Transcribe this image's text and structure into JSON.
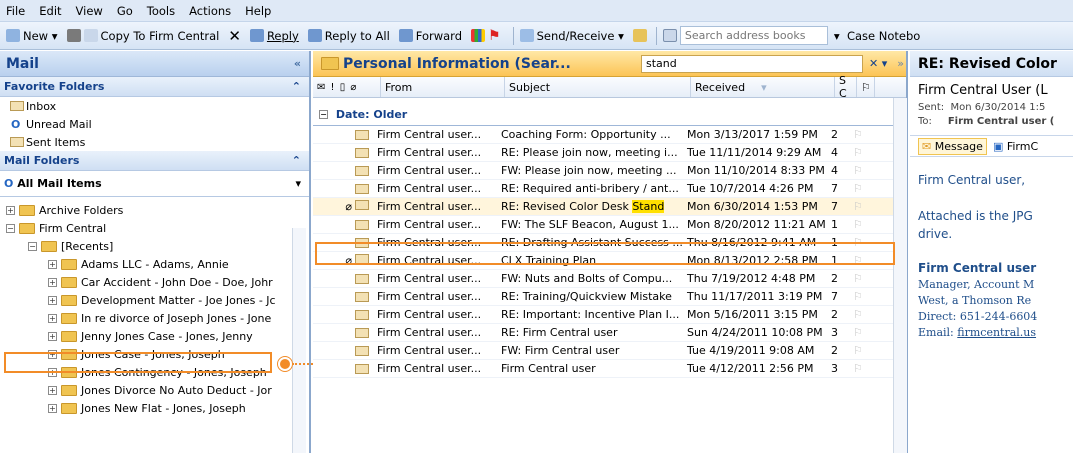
{
  "menu": [
    "File",
    "Edit",
    "View",
    "Go",
    "Tools",
    "Actions",
    "Help"
  ],
  "toolbar": {
    "new": "New",
    "copy_to": "Copy To Firm Central",
    "reply": "Reply",
    "reply_all": "Reply to All",
    "forward": "Forward",
    "send_receive": "Send/Receive",
    "search_ab": "Search address books",
    "case_notebook": "Case Notebo"
  },
  "nav": {
    "title": "Mail",
    "fav_title": "Favorite Folders",
    "favorites": [
      "Inbox",
      "Unread Mail",
      "Sent Items"
    ],
    "mail_folders_title": "Mail Folders",
    "all_mail": "All Mail Items",
    "tree": [
      "Archive Folders",
      "Firm Central",
      "[Recents]",
      "Adams LLC - Adams, Annie",
      "Car Accident - John Doe - Doe, Johr",
      "Development Matter - Joe Jones - Jc",
      "In re divorce of Joseph Jones - Jone",
      "Jenny Jones Case - Jones, Jenny",
      "Jones Case - Jones, Joseph",
      "Jones Contingency - Jones, Joseph",
      "Jones Divorce No Auto Deduct - Jor",
      "Jones New Flat - Jones, Joseph"
    ]
  },
  "list": {
    "title": "Personal Information (Sear...",
    "search_value": "stand",
    "cols": {
      "from": "From",
      "subject": "Subject",
      "received": "Received",
      "sc": "S C"
    },
    "group": "Date: Older",
    "rows": [
      {
        "from": "Firm Central user...",
        "subject": "Coaching Form: Opportunity ...",
        "received": "Mon 3/13/2017 1:59 PM",
        "size": "2"
      },
      {
        "from": "Firm Central user...",
        "subject": "RE: Please join now, meeting i...",
        "received": "Tue 11/11/2014 9:29 AM",
        "size": "4"
      },
      {
        "from": "Firm Central user...",
        "subject": "FW: Please join now, meeting ...",
        "received": "Mon 11/10/2014 8:33 PM",
        "size": "4"
      },
      {
        "from": "Firm Central user...",
        "subject": "RE: Required anti-bribery / ant...",
        "received": "Tue 10/7/2014 4:26 PM",
        "size": "7"
      },
      {
        "from": "Firm Central user...",
        "subject": "RE: Revised Color Desk ",
        "subject_hl": "Stand",
        "received": "Mon 6/30/2014 1:53 PM",
        "size": "7"
      },
      {
        "from": "Firm Central user...",
        "subject": "FW: The SLF Beacon, August 1...",
        "received": "Mon 8/20/2012 11:21 AM",
        "size": "1"
      },
      {
        "from": "Firm Central user...",
        "subject": "RE: Drafting Assistant Success ...",
        "received": "Thu 8/16/2012 9:41 AM",
        "size": "1"
      },
      {
        "from": "Firm Central user...",
        "subject": "CLX Training Plan",
        "received": "Mon 8/13/2012 2:58 PM",
        "size": "1"
      },
      {
        "from": "Firm Central user...",
        "subject": "FW: Nuts and Bolts of Compu...",
        "received": "Thu 7/19/2012 4:48 PM",
        "size": "2"
      },
      {
        "from": "Firm Central user...",
        "subject": "RE: Training/Quickview Mistake",
        "received": "Thu 11/17/2011 3:19 PM",
        "size": "7"
      },
      {
        "from": "Firm Central user...",
        "subject": "RE: Important: Incentive Plan I...",
        "received": "Mon 5/16/2011 3:15 PM",
        "size": "2"
      },
      {
        "from": "Firm Central user...",
        "subject": "RE: Firm Central user",
        "received": "Sun 4/24/2011 10:08 PM",
        "size": "3"
      },
      {
        "from": "Firm Central user...",
        "subject": "FW: Firm Central user",
        "received": "Tue 4/19/2011 9:08 AM",
        "size": "2"
      },
      {
        "from": "Firm Central user...",
        "subject": "Firm Central user",
        "received": "Tue 4/12/2011 2:56 PM",
        "size": "3"
      }
    ]
  },
  "reading": {
    "title": "RE: Revised Color",
    "from_name": "Firm Central User (L",
    "sent_label": "Sent:",
    "sent_value": "Mon 6/30/2014 1:5",
    "to_label": "To:",
    "to_value": "Firm Central user (",
    "tab_message": "Message",
    "tab_firm": "FirmC",
    "greeting": "Firm Central user,",
    "body1": "Attached is the JPG",
    "body2": "drive.",
    "sig_name": "Firm Central user",
    "sig1": "Manager, Account M",
    "sig2": "West, a Thomson Re",
    "sig3": "Direct: 651-244-6604",
    "sig4_label": "Email: ",
    "sig4_link": "firmcentral.us"
  },
  "colors": {
    "accent": "#15428b",
    "highlight": "#f28c28",
    "search_hl": "#ffe000"
  }
}
